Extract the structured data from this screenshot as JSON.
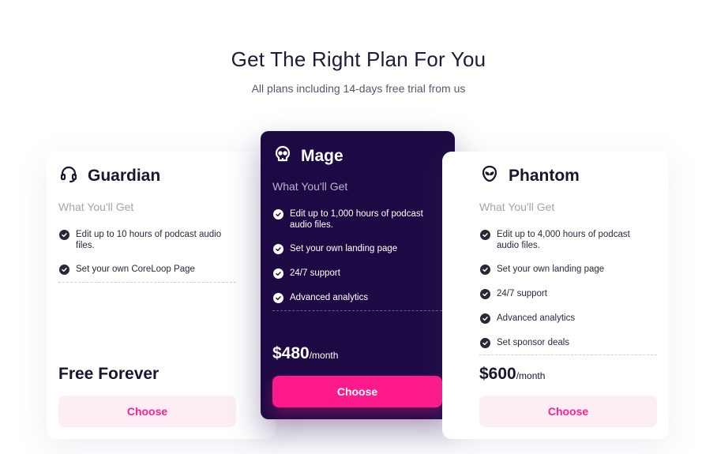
{
  "header": {
    "title": "Get The Right Plan For You",
    "subtitle": "All plans including 14-days free trial from us"
  },
  "colors": {
    "accent": "#ff1a8c",
    "featured_bg": "#1d0a45",
    "light_button_bg": "#fdeef5"
  },
  "plans": [
    {
      "name": "Guardian",
      "icon": "headset-icon",
      "section_label": "What You'll Get",
      "features": [
        "Edit up to 10 hours of podcast audio files.",
        "Set your own CoreLoop Page"
      ],
      "price_label": "Free Forever",
      "button_label": "Choose"
    },
    {
      "name": "Mage",
      "icon": "skull-icon",
      "featured": true,
      "section_label": "What You'll Get",
      "features": [
        "Edit up to 1,000 hours of podcast audio files.",
        "Set your own landing page",
        "24/7 support",
        "Advanced analytics"
      ],
      "price": "$480",
      "price_period": "/month",
      "button_label": "Choose"
    },
    {
      "name": "Phantom",
      "icon": "alien-icon",
      "section_label": "What You'll Get",
      "features": [
        "Edit up to 4,000 hours of podcast audio files.",
        "Set your own landing page",
        "24/7 support",
        "Advanced analytics",
        "Set sponsor deals"
      ],
      "price": "$600",
      "price_period": "/month",
      "button_label": "Choose"
    }
  ]
}
